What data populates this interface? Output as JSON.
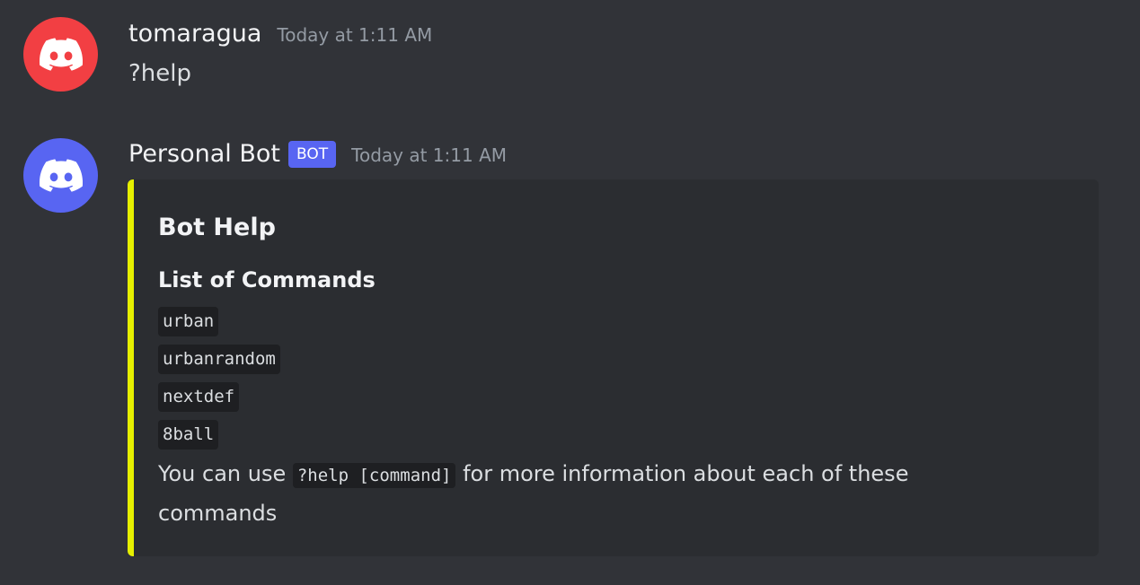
{
  "messages": [
    {
      "username": "tomaragua",
      "timestamp": "Today at 1:11 AM",
      "avatar_color": "#f23f43",
      "avatar_icon": "discord-logo-icon",
      "content": "?help"
    },
    {
      "username": "Personal Bot",
      "bot_tag": "BOT",
      "timestamp": "Today at 1:11 AM",
      "avatar_color": "#5865f2",
      "avatar_icon": "discord-logo-icon",
      "embed": {
        "accent_color": "#e6f000",
        "title": "Bot Help",
        "field_name": "List of Commands",
        "commands": [
          "urban",
          "urbanrandom",
          "nextdef",
          "8ball"
        ],
        "description_before": "You can use ",
        "description_code": "?help [command]",
        "description_after": " for more information about each of these commands"
      }
    }
  ]
}
